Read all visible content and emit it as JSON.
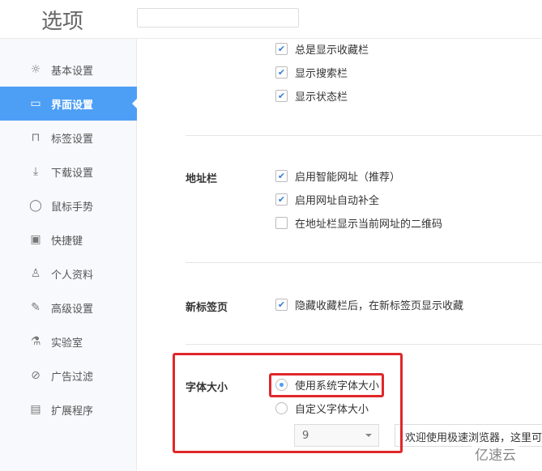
{
  "header": {
    "title": "选项",
    "search_value": ""
  },
  "sidebar": {
    "items": [
      {
        "label": "基本设置",
        "icon": "sun-icon",
        "glyph": "☼"
      },
      {
        "label": "界面设置",
        "icon": "window-icon",
        "glyph": "▭",
        "active": true
      },
      {
        "label": "标签设置",
        "icon": "tab-icon",
        "glyph": "⊓"
      },
      {
        "label": "下载设置",
        "icon": "download-icon",
        "glyph": "⤓"
      },
      {
        "label": "鼠标手势",
        "icon": "mouse-icon",
        "glyph": "◯"
      },
      {
        "label": "快捷键",
        "icon": "keyboard-icon",
        "glyph": "▣"
      },
      {
        "label": "个人资料",
        "icon": "user-icon",
        "glyph": "♙"
      },
      {
        "label": "高级设置",
        "icon": "wrench-icon",
        "glyph": "✎"
      },
      {
        "label": "实验室",
        "icon": "flask-icon",
        "glyph": "⚗"
      },
      {
        "label": "广告过滤",
        "icon": "block-icon",
        "glyph": "⊘"
      },
      {
        "label": "扩展程序",
        "icon": "extension-icon",
        "glyph": "▤"
      }
    ]
  },
  "toolbar_section": {
    "options": [
      {
        "label": "总是显示收藏栏",
        "checked": true
      },
      {
        "label": "显示搜索栏",
        "checked": true
      },
      {
        "label": "显示状态栏",
        "checked": true
      }
    ]
  },
  "address_bar": {
    "label": "地址栏",
    "options": [
      {
        "label": "启用智能网址（推荐）",
        "checked": true
      },
      {
        "label": "启用网址自动补全",
        "checked": true
      },
      {
        "label": "在地址栏显示当前网址的二维码",
        "checked": false
      }
    ]
  },
  "new_tab": {
    "label": "新标签页",
    "options": [
      {
        "label": "隐藏收藏栏后，在新标签页显示收藏",
        "checked": true
      }
    ]
  },
  "font_size": {
    "label": "字体大小",
    "system": "使用系统字体大小",
    "custom": "自定义字体大小",
    "selected": "system",
    "size_value": "9",
    "preview": "欢迎使用极速浏览器，这里可以"
  },
  "watermark": "亿速云",
  "colors": {
    "accent": "#4d9ff5",
    "highlight": "#e0272a"
  }
}
